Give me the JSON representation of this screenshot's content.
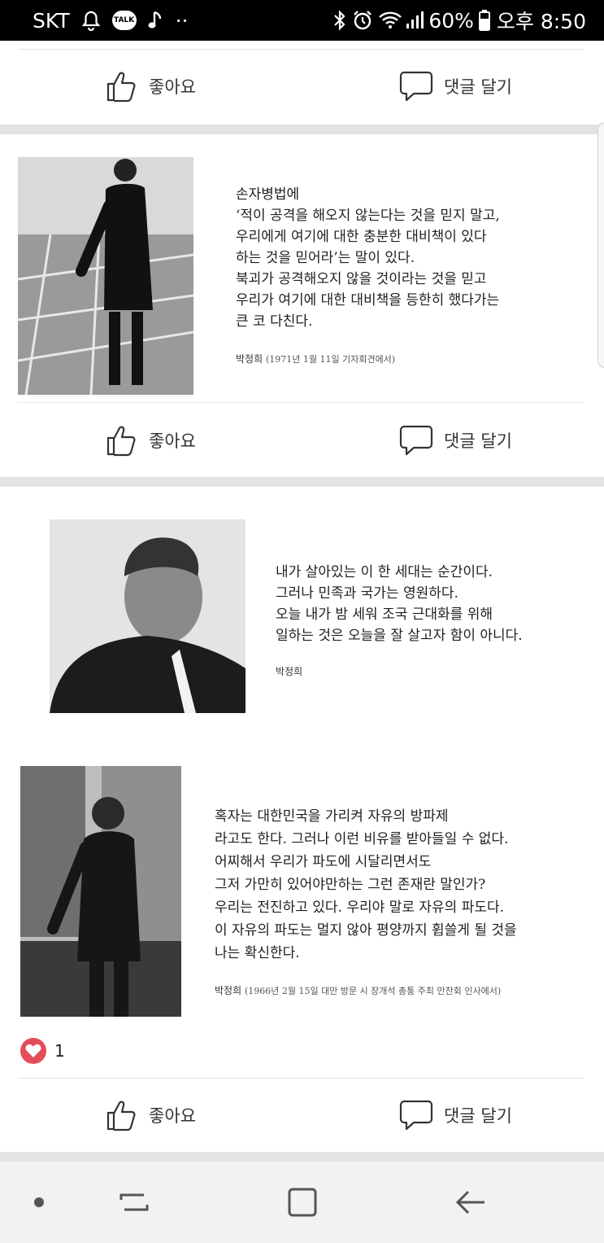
{
  "status_bar": {
    "carrier": "SKT",
    "talk_badge": "TALK",
    "dots": "··",
    "battery": "60%",
    "time": "오후 8:50",
    "icons": [
      "bell-icon",
      "kakaotalk-icon",
      "music-note-icon",
      "bluetooth-icon",
      "alarm-icon",
      "wifi-icon",
      "signal-icon",
      "battery-icon"
    ]
  },
  "actions": {
    "like": "좋아요",
    "comment": "댓글 달기"
  },
  "post1": {
    "quote_lines": [
      "손자병법에",
      "‘적이 공격을 해오지 않는다는 것을 믿지 말고,",
      "우리에게 여기에 대한 충분한 대비책이 있다",
      "하는 것을 믿어라’는 말이 있다.",
      "북괴가 공격해오지 않을 것이라는 것을 믿고",
      "우리가 여기에 대한 대비책을 등한히 했다가는",
      "큰 코 다친다."
    ],
    "author": "박정희",
    "source": "(1971년 1월 11일 기자회견에서)"
  },
  "post2": {
    "quote1_lines": [
      "내가 살아있는 이 한 세대는 순간이다.",
      "그러나 민족과 국가는 영원하다.",
      "오늘 내가 밤 세워 조국 근대화를 위해",
      "일하는 것은 오늘을 잘 살고자 함이 아니다."
    ],
    "quote1_author": "박정희",
    "quote2_lines": [
      "혹자는 대한민국을 가리켜 자유의 방파제",
      "라고도 한다. 그러나 이런 비유를 받아들일 수 없다.",
      "어찌해서 우리가 파도에 시달리면서도",
      "그저 가만히 있어야만하는 그런 존재란 말인가?",
      "우리는 전진하고 있다. 우리야 말로 자유의 파도다.",
      "이 자유의 파도는 멀지 않아 평양까지 휩쓸게 될 것을",
      "나는 확신한다."
    ],
    "quote2_author": "박정희",
    "quote2_source": "(1966년 2월 15일 대만 방문 시 장개석 총통 주최 만찬회 인사에서)",
    "like_count": "1"
  },
  "nav_bar": {
    "icons": [
      "dot-icon",
      "recent-apps-icon",
      "home-icon",
      "back-icon"
    ]
  },
  "colors": {
    "heart": "#e44c5a",
    "separator": "#e3e3e6",
    "status_bar": "#000000"
  }
}
